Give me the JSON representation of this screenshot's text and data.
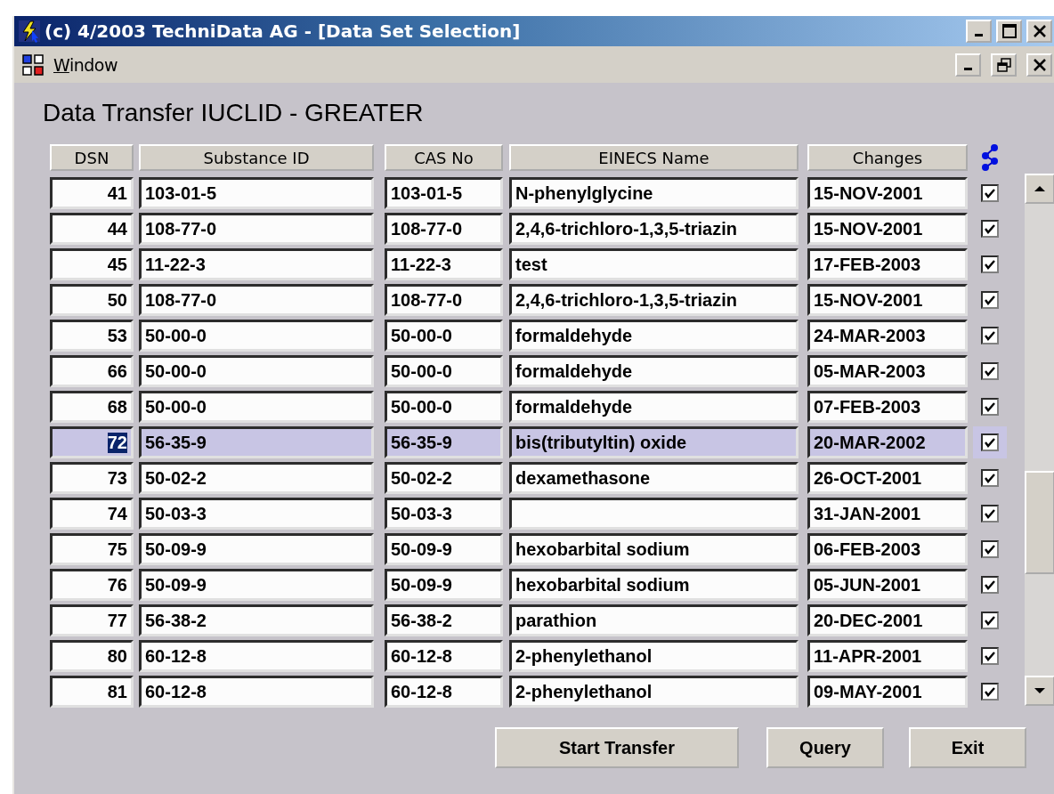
{
  "window": {
    "title": "(c) 4/2003 TechniData AG - [Data Set Selection]"
  },
  "menu": {
    "items": [
      {
        "label": "Window"
      }
    ]
  },
  "heading": "Data Transfer IUCLID - GREATER",
  "table": {
    "columns": [
      "DSN",
      "Substance ID",
      "CAS No",
      "EINECS Name",
      "Changes"
    ],
    "rows": [
      {
        "dsn": "41",
        "substance_id": "103-01-5",
        "cas_no": "103-01-5",
        "einecs_name": "N-phenylglycine",
        "changes": "15-NOV-2001",
        "checked": true,
        "selected": false
      },
      {
        "dsn": "44",
        "substance_id": "108-77-0",
        "cas_no": "108-77-0",
        "einecs_name": "2,4,6-trichloro-1,3,5-triazin",
        "changes": "15-NOV-2001",
        "checked": true,
        "selected": false
      },
      {
        "dsn": "45",
        "substance_id": "11-22-3",
        "cas_no": "11-22-3",
        "einecs_name": "test",
        "changes": "17-FEB-2003",
        "checked": true,
        "selected": false
      },
      {
        "dsn": "50",
        "substance_id": "108-77-0",
        "cas_no": "108-77-0",
        "einecs_name": "2,4,6-trichloro-1,3,5-triazin",
        "changes": "15-NOV-2001",
        "checked": true,
        "selected": false
      },
      {
        "dsn": "53",
        "substance_id": "50-00-0",
        "cas_no": "50-00-0",
        "einecs_name": "formaldehyde",
        "changes": "24-MAR-2003",
        "checked": true,
        "selected": false
      },
      {
        "dsn": "66",
        "substance_id": "50-00-0",
        "cas_no": "50-00-0",
        "einecs_name": "formaldehyde",
        "changes": "05-MAR-2003",
        "checked": true,
        "selected": false
      },
      {
        "dsn": "68",
        "substance_id": "50-00-0",
        "cas_no": "50-00-0",
        "einecs_name": "formaldehyde",
        "changes": "07-FEB-2003",
        "checked": true,
        "selected": false
      },
      {
        "dsn": "72",
        "substance_id": "56-35-9",
        "cas_no": "56-35-9",
        "einecs_name": "bis(tributyltin) oxide",
        "changes": "20-MAR-2002",
        "checked": true,
        "selected": true
      },
      {
        "dsn": "73",
        "substance_id": "50-02-2",
        "cas_no": "50-02-2",
        "einecs_name": "dexamethasone",
        "changes": "26-OCT-2001",
        "checked": true,
        "selected": false
      },
      {
        "dsn": "74",
        "substance_id": "50-03-3",
        "cas_no": "50-03-3",
        "changes": "31-JAN-2001",
        "checked": true,
        "selected": false
      },
      {
        "dsn": "75",
        "substance_id": "50-09-9",
        "cas_no": "50-09-9",
        "einecs_name": "hexobarbital sodium",
        "changes": "06-FEB-2003",
        "checked": true,
        "selected": false
      },
      {
        "dsn": "76",
        "substance_id": "50-09-9",
        "cas_no": "50-09-9",
        "einecs_name": "hexobarbital sodium",
        "changes": "05-JUN-2001",
        "checked": true,
        "selected": false
      },
      {
        "dsn": "77",
        "substance_id": "56-38-2",
        "cas_no": "56-38-2",
        "einecs_name": "parathion",
        "changes": "20-DEC-2001",
        "checked": true,
        "selected": false
      },
      {
        "dsn": "80",
        "substance_id": "60-12-8",
        "cas_no": "60-12-8",
        "einecs_name": "2-phenylethanol",
        "changes": "11-APR-2001",
        "checked": true,
        "selected": false
      },
      {
        "dsn": "81",
        "substance_id": "60-12-8",
        "cas_no": "60-12-8",
        "einecs_name": "2-phenylethanol",
        "changes": "09-MAY-2001",
        "checked": true,
        "selected": false
      }
    ]
  },
  "buttons": [
    "Start Transfer",
    "Query",
    "Exit"
  ]
}
